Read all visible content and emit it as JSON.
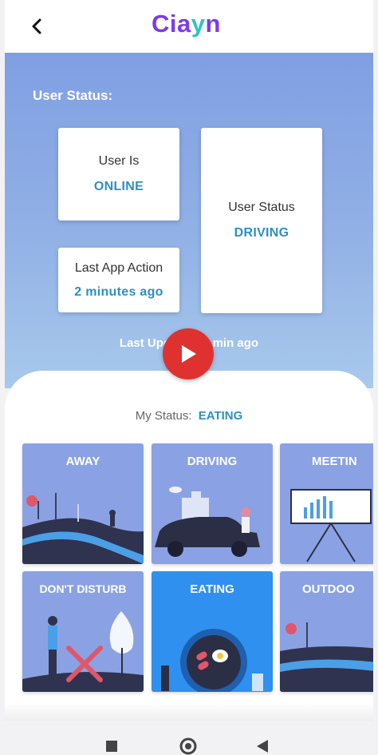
{
  "header": {
    "back_icon": "chevron-left-icon",
    "logo_left": "Cia",
    "logo_mid": "y",
    "logo_right": "n"
  },
  "user_status": {
    "title": "User Status:",
    "online_card": {
      "label": "User Is",
      "value": "ONLINE"
    },
    "status_card": {
      "label": "User Status",
      "value": "DRIVING"
    },
    "action_card": {
      "label": "Last App Action",
      "value": "2 minutes ago"
    },
    "last_updated": "Last Updated: 1 min ago"
  },
  "video_overlay": {
    "icon": "play-icon",
    "color": "#e03131"
  },
  "my_status": {
    "label": "My Status:",
    "value": "EATING"
  },
  "status_options": [
    {
      "label": "AWAY",
      "selected": false
    },
    {
      "label": "DRIVING",
      "selected": false
    },
    {
      "label": "MEETIN",
      "selected": false
    },
    {
      "label": "DON'T DISTURB",
      "selected": false
    },
    {
      "label": "EATING",
      "selected": true
    },
    {
      "label": "OUTDOO",
      "selected": false
    }
  ],
  "nav": {
    "icons": [
      "square-icon",
      "circle-icon",
      "triangle-back-icon"
    ]
  },
  "colors": {
    "accent": "#2e8fc4",
    "brand": "#7c3aed",
    "tile": "#8aa2e3",
    "tile_selected": "#2f90ef"
  }
}
